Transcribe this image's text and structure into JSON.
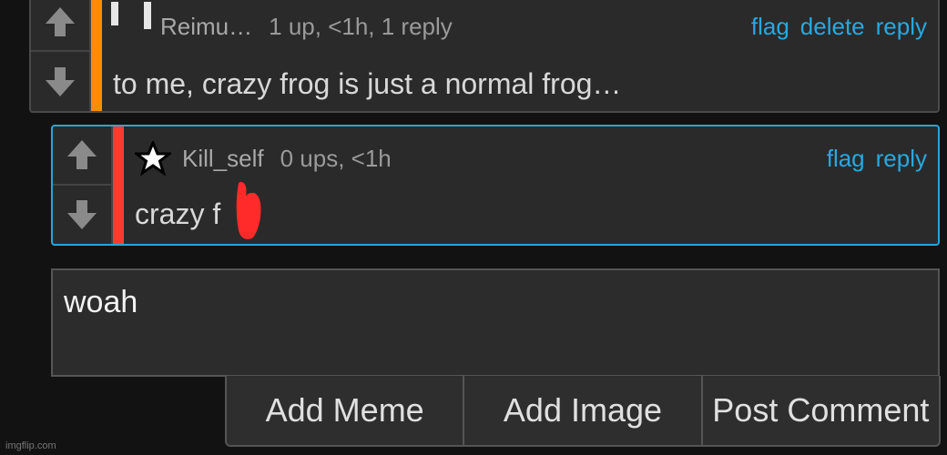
{
  "colors": {
    "accent_link": "#27a9e1",
    "rank_orange": "#ff8c00",
    "rank_red": "#ff3b30",
    "highlight_border": "#2aa4d8"
  },
  "comment1": {
    "username": "Reimu…",
    "meta": "1 up, <1h, 1 reply",
    "actions": {
      "flag": "flag",
      "delete": "delete",
      "reply": "reply"
    },
    "text": "to me, crazy frog is just a normal frog…",
    "icons": {
      "upvote": "arrow-up-icon",
      "downvote": "arrow-down-icon"
    }
  },
  "comment2": {
    "username": "Kill_self",
    "meta": "0 ups, <1h",
    "actions": {
      "flag": "flag",
      "reply": "reply"
    },
    "text": "crazy f",
    "icons": {
      "badge": "star-badge-icon",
      "upvote": "arrow-up-icon",
      "downvote": "arrow-down-icon"
    }
  },
  "reply": {
    "value": "woah"
  },
  "buttons": {
    "add_meme": "Add Meme",
    "add_image": "Add Image",
    "post_comment": "Post Comment"
  },
  "watermark": "imgflip.com"
}
